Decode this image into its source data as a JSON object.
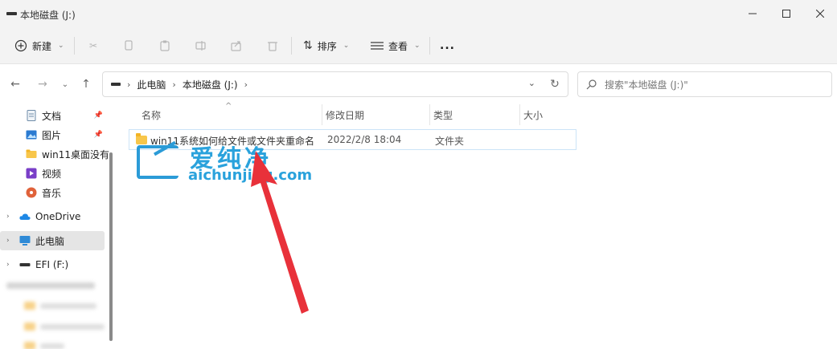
{
  "window": {
    "title": "本地磁盘 (J:)",
    "minimize_icon": "minimize-icon",
    "maximize_icon": "maximize-icon",
    "close_icon": "close-icon"
  },
  "toolbar": {
    "new_label": "新建",
    "sort_label": "排序",
    "view_label": "查看",
    "more_label": "..."
  },
  "address": {
    "crumbs": [
      "此电脑",
      "本地磁盘 (J:)"
    ],
    "search_placeholder": "搜索\"本地磁盘 (J:)\""
  },
  "sidebar": {
    "items": [
      {
        "label": "文档",
        "icon": "document-icon",
        "pinned": true
      },
      {
        "label": "图片",
        "icon": "pictures-icon",
        "pinned": true
      },
      {
        "label": "win11桌面没有l",
        "icon": "folder-icon"
      },
      {
        "label": "视频",
        "icon": "video-icon"
      },
      {
        "label": "音乐",
        "icon": "music-icon"
      },
      {
        "label": "OneDrive",
        "icon": "cloud-icon"
      },
      {
        "label": "此电脑",
        "icon": "computer-icon"
      },
      {
        "label": "EFI (F:)",
        "icon": "drive-icon"
      }
    ]
  },
  "columns": [
    "名称",
    "修改日期",
    "类型",
    "大小"
  ],
  "files": [
    {
      "name": "win11系统如何给文件或文件夹重命名",
      "modified": "2022/2/8 18:04",
      "type": "文件夹",
      "size": ""
    }
  ],
  "watermark": {
    "cn": "爱纯净",
    "en": "aichunjing.com"
  },
  "colors": {
    "accent": "#2aa2dc",
    "arrow": "#e8313a",
    "folder": "#f8c64a",
    "selection": "#cce4f7"
  }
}
